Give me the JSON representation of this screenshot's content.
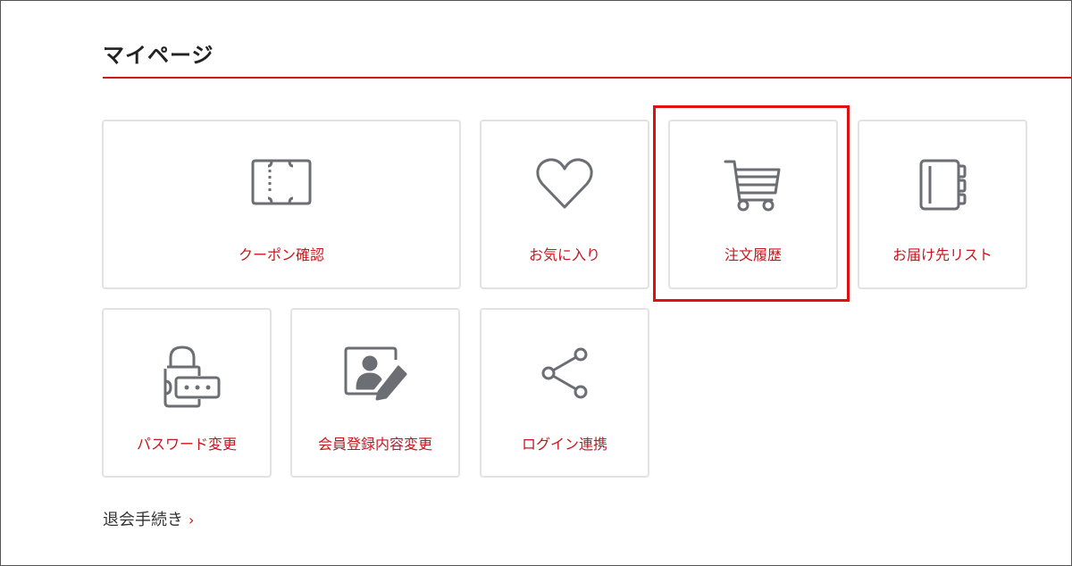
{
  "page": {
    "title": "マイページ"
  },
  "tiles": [
    {
      "label": "クーポン確認",
      "icon": "ticket-icon"
    },
    {
      "label": "お気に入り",
      "icon": "heart-icon"
    },
    {
      "label": "注文履歴",
      "icon": "cart-icon"
    },
    {
      "label": "お届け先リスト",
      "icon": "address-book-icon"
    },
    {
      "label": "パスワード変更",
      "icon": "lock-password-icon"
    },
    {
      "label": "会員登録内容変更",
      "icon": "profile-edit-icon"
    },
    {
      "label": "ログイン連携",
      "icon": "share-icon"
    }
  ],
  "withdraw": {
    "label": "退会手続き",
    "chevron": "›"
  },
  "colors": {
    "accent": "#c8161d",
    "highlight": "#e01010",
    "icon": "#6b6e73",
    "border": "#e2e2e2"
  }
}
